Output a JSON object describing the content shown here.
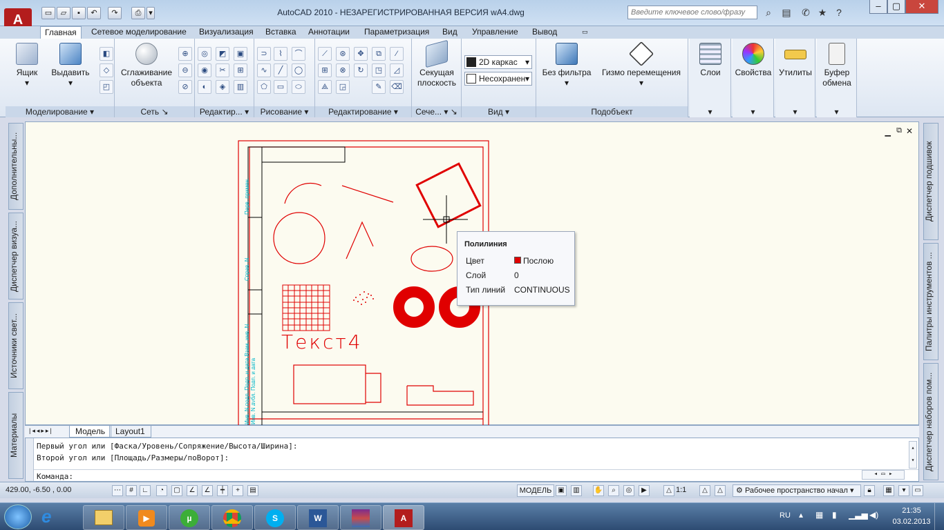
{
  "window": {
    "title": "AutoCAD 2010 - НЕЗАРЕГИСТРИРОВАННАЯ ВЕРСИЯ     wA4.dwg",
    "search_placeholder": "Введите ключевое слово/фразу"
  },
  "ribbon_tabs": [
    "Главная",
    "Сетевое моделирование",
    "Визуализация",
    "Вставка",
    "Аннотации",
    "Параметризация",
    "Вид",
    "Управление",
    "Вывод"
  ],
  "ribbon": {
    "box": "Ящик",
    "extrude": "Выдавить",
    "smooth": "Сглаживание объекта",
    "section": "Секущая плоскость",
    "visual_style": "2D каркас",
    "view_state": "Несохранен",
    "filter": "Без фильтра",
    "gizmo": "Гизмо перемещения",
    "layers": "Слои",
    "properties": "Свойства",
    "utilities": "Утилиты",
    "clipboard": "Буфер обмена",
    "panels": {
      "modeling": "Моделирование",
      "mesh": "Сеть",
      "edit1": "Редактир...",
      "draw": "Рисование",
      "edit2": "Редактирование",
      "section": "Сече...",
      "view": "Вид",
      "subobject": "Подобъект"
    }
  },
  "side_palettes": {
    "left": [
      "Дополнительны...",
      "Диспетчер визуа...",
      "Источники свет...",
      "Материалы"
    ],
    "right": [
      "Диспетчер подшивок",
      "Палитры инструментов ...",
      "Диспетчер наборов пом..."
    ]
  },
  "drawing": {
    "text": "Текст4",
    "frame_labels": [
      "Перв. примен.",
      "Справ. N",
      "Инв. N подл. Подп. и дата Взам. инв. N Инв. N дубл. Подп. и дата"
    ]
  },
  "tooltip": {
    "title": "Полилиния",
    "rows": [
      {
        "k": "Цвет",
        "v": "Послою",
        "color": "#e00000"
      },
      {
        "k": "Слой",
        "v": "0"
      },
      {
        "k": "Тип линий",
        "v": "CONTINUOUS"
      }
    ]
  },
  "layout_tabs": [
    "Модель",
    "Layout1"
  ],
  "command": {
    "line1": "Первый угол или [Фаска/Уровень/Сопряжение/Высота/Ширина]:",
    "line2": "Второй угол или [Площадь/Размеры/поВорот]:",
    "prompt": "Команда:"
  },
  "status": {
    "coords": "429.00, -6.50 , 0.00",
    "model": "МОДЕЛЬ",
    "scale": "1:1",
    "workspace": "Рабочее пространство начал"
  },
  "taskbar": {
    "lang": "RU",
    "time": "21:35",
    "date": "03.02.2013"
  },
  "colors": {
    "accent": "#b31d1d",
    "drawing_red": "#e00000",
    "cyan_text": "#00b4c8"
  }
}
